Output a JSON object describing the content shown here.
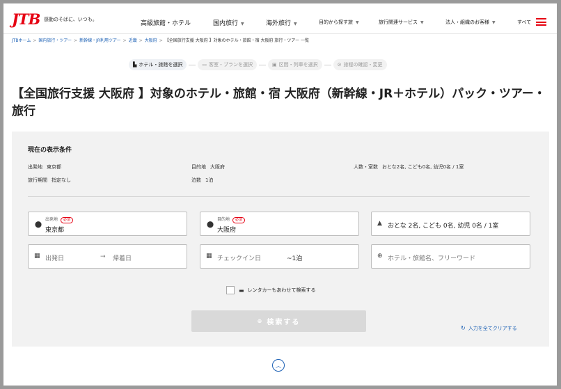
{
  "header": {
    "logo": "JTB",
    "tagline": "感動のそばに、いつも。",
    "nav": [
      {
        "label": "高級旅館・ホテル",
        "caret": false
      },
      {
        "label": "国内旅行",
        "caret": true
      },
      {
        "label": "海外旅行",
        "caret": true
      },
      {
        "label": "目的から探す旅",
        "caret": true
      },
      {
        "label": "旅行関連サービス",
        "caret": true
      },
      {
        "label": "法人・組織のお客様",
        "caret": true
      },
      {
        "label": "すべて",
        "caret": false
      }
    ],
    "menu_icon": "hamburger-icon",
    "brand_color": "#e60012"
  },
  "breadcrumb": {
    "items": [
      "JTBホーム",
      "国内旅行・ツアー",
      "新幹線・JR利用ツアー",
      "近畿",
      "大阪府"
    ],
    "current": "【全国旅行支援 大阪府 】対象のホテル・旅館・宿 大阪府 旅行・ツアー 一覧",
    "separator": ">"
  },
  "steps": [
    {
      "label": "ホテル・旅館を選択",
      "icon": "hotel-icon",
      "active": true
    },
    {
      "label": "客室・プランを選択",
      "icon": "bed-icon",
      "active": false
    },
    {
      "label": "区間・列車を選択",
      "icon": "train-icon",
      "active": false
    },
    {
      "label": "旅程の確認・変更",
      "icon": "check-icon",
      "active": false
    }
  ],
  "page_title": "【全国旅行支援 大阪府 】対象のホテル・旅館・宿 大阪府（新幹線・JR＋ホテル）パック・ツアー・旅行",
  "conditions": {
    "title": "現在の表示条件",
    "departure_label": "出発地",
    "departure_value": "東京都",
    "destination_label": "目的地",
    "destination_value": "大阪府",
    "people_label": "人数・室数",
    "people_value": "おとな2名, こども0名, 幼児0名 / 1室",
    "period_label": "旅行期間",
    "period_value": "指定なし",
    "nights_label": "泊数",
    "nights_value": "1泊"
  },
  "form": {
    "departure": {
      "label": "出発地",
      "required": "必須",
      "value": "東京都"
    },
    "destination": {
      "label": "目的地",
      "required": "必須",
      "value": "大阪府"
    },
    "guests": {
      "value": "おとな 2名, こども 0名, 幼児 0名 / 1室"
    },
    "depart_date": {
      "placeholder": "出発日"
    },
    "return_date": {
      "placeholder": "帰着日"
    },
    "arrow": "→",
    "checkin": {
      "placeholder": "チェックイン日",
      "nights": "~1泊"
    },
    "keyword": {
      "placeholder": "ホテル・旅館名、フリーワード"
    },
    "rental_car": "レンタカーもあわせて検索する",
    "search_button": "検索する",
    "clear_link": "入力を全てクリアする"
  },
  "accent_color": "#1a5fb4"
}
